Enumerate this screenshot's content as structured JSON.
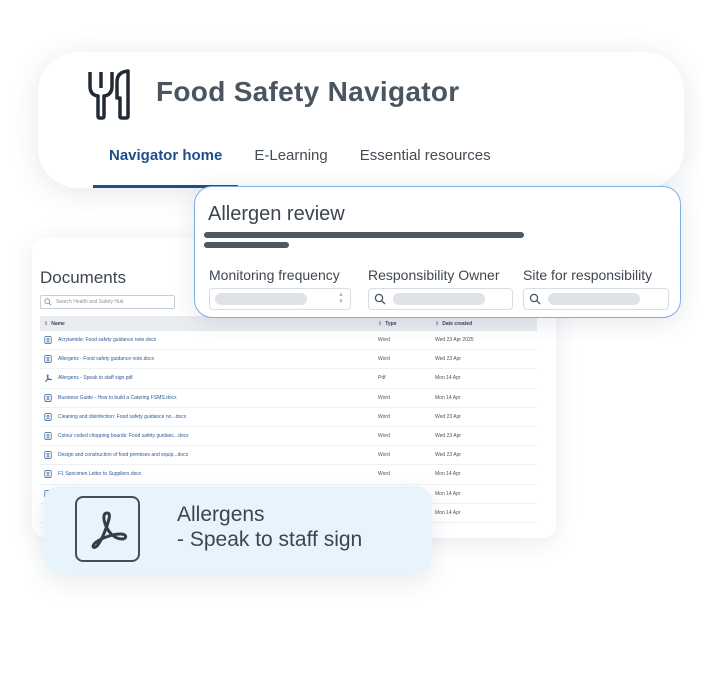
{
  "header": {
    "title": "Food Safety Navigator",
    "logo_icon": "cutlery-icon",
    "tabs": [
      {
        "label": "Navigator home",
        "active": true
      },
      {
        "label": "E-Learning",
        "active": false
      },
      {
        "label": "Essential resources",
        "active": false
      }
    ]
  },
  "documents": {
    "title": "Documents",
    "search_placeholder": "Search Health and Safety Hub",
    "columns": {
      "name": "Name",
      "type": "Type",
      "date": "Date created"
    },
    "rows": [
      {
        "name": "Acrylamide: Food safety guidance note.docx",
        "type": "Word",
        "date": "Wed 23 Apr 2025",
        "icon": "word-doc-icon"
      },
      {
        "name": "Allergens - Food safety guidance note.docx",
        "type": "Word",
        "date": "Wed 23 Apr",
        "icon": "word-doc-icon"
      },
      {
        "name": "Allergens - Speak to staff sign.pdf",
        "type": "Pdf",
        "date": "Mon 14 Apr",
        "icon": "pdf-icon"
      },
      {
        "name": "Business Guide - How to build a Catering FSMS.docx",
        "type": "Word",
        "date": "Mon 14 Apr",
        "icon": "word-doc-icon"
      },
      {
        "name": "Cleaning and disinfection: Food safety guidance no...docx",
        "type": "Word",
        "date": "Wed 23 Apr",
        "icon": "word-doc-icon"
      },
      {
        "name": "Colour coded chopping boards: Food safety guidanc...docx",
        "type": "Word",
        "date": "Wed 23 Apr",
        "icon": "word-doc-icon"
      },
      {
        "name": "Design and construction of food premises and equip...docx",
        "type": "Word",
        "date": "Wed 23 Apr",
        "icon": "word-doc-icon"
      },
      {
        "name": "F1 Specimen Letter to Suppliers.docx",
        "type": "Word",
        "date": "Mon 14 Apr",
        "icon": "word-doc-icon"
      },
      {
        "name": "",
        "type": "",
        "date": "Mon 14 Apr",
        "icon": "word-doc-icon"
      },
      {
        "name": "",
        "type": "",
        "date": "Mon 14 Apr",
        "icon": "word-doc-icon"
      }
    ]
  },
  "review": {
    "title": "Allergen review",
    "filters": [
      {
        "label": "Monitoring frequency",
        "control": "select"
      },
      {
        "label": "Responsibility Owner",
        "control": "search"
      },
      {
        "label": "Site for responsibility",
        "control": "search"
      }
    ]
  },
  "callout": {
    "line1": "Allergens",
    "line2": "- Speak to staff sign",
    "icon": "pdf-icon"
  },
  "colors": {
    "accent": "#1f4f8b",
    "review_border": "#7eaee6",
    "callout_bg": "#e8f4fc",
    "text_dark": "#404b57"
  }
}
